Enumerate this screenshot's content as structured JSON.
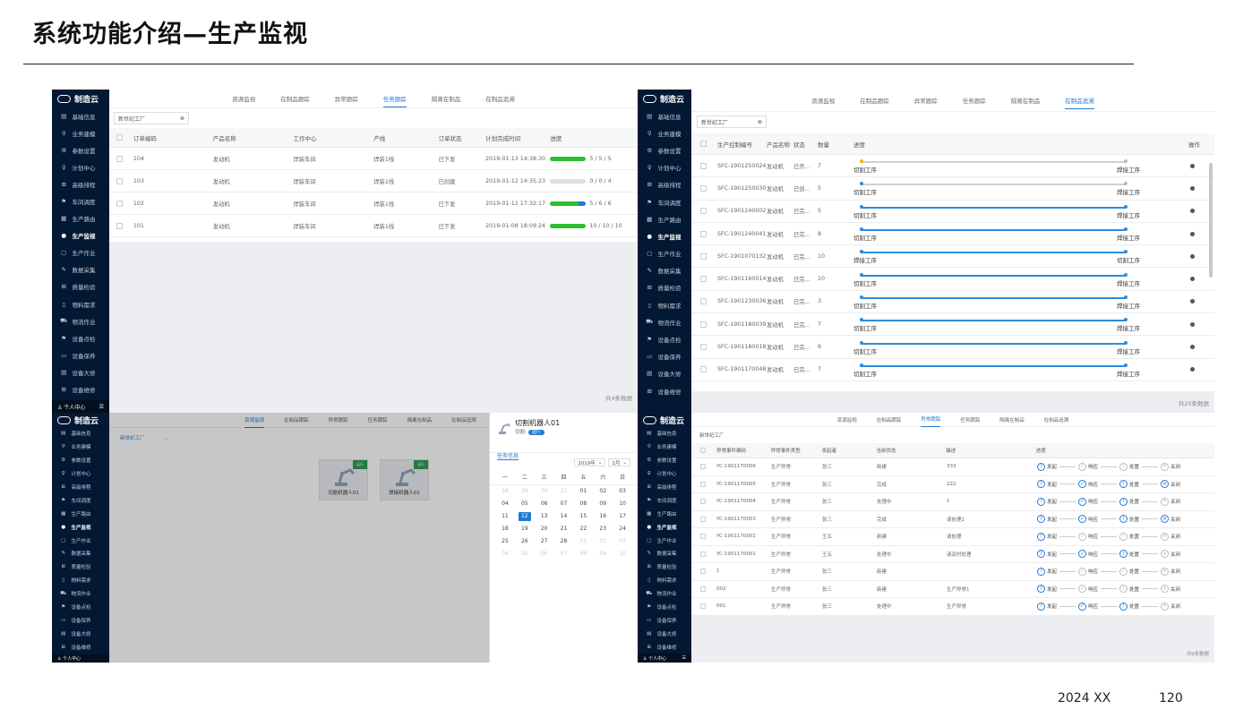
{
  "slide": {
    "title": "系统功能介绍—生产监视",
    "footer_left": "2024 XX",
    "footer_right": "120"
  },
  "app": {
    "brand": "制造云",
    "user_center": "个人中心",
    "menu_toggle": "☰"
  },
  "sidebar_items": [
    {
      "label": "基础信息",
      "icon": "▤"
    },
    {
      "label": "业务建模",
      "icon": "⚲"
    },
    {
      "label": "参数设置",
      "icon": "⚙"
    },
    {
      "label": "计划中心",
      "icon": "♀"
    },
    {
      "label": "高级排程",
      "icon": "⊞"
    },
    {
      "label": "车间调度",
      "icon": "⚑"
    },
    {
      "label": "生产路由",
      "icon": "▦"
    },
    {
      "label": "生产监视",
      "icon": "●",
      "active": true
    },
    {
      "label": "生产作业",
      "icon": "▢"
    },
    {
      "label": "数据采集",
      "icon": "✎"
    },
    {
      "label": "质量检验",
      "icon": "⊞"
    },
    {
      "label": "物料需求",
      "icon": "▯"
    },
    {
      "label": "物流作业",
      "icon": "⛟"
    },
    {
      "label": "设备点检",
      "icon": "⚑"
    },
    {
      "label": "设备保养",
      "icon": "▭"
    },
    {
      "label": "设备大修",
      "icon": "▤"
    },
    {
      "label": "设备维修",
      "icon": "⊞"
    }
  ],
  "tabs": [
    "资源监视",
    "在制品跟踪",
    "异常跟踪",
    "任务跟踪",
    "隔离在制品",
    "在制品追溯"
  ],
  "filter": {
    "factory": "新世纪工厂",
    "clear": "⊗",
    "dropdown": "新世纪工厂",
    "caret": "⌄"
  },
  "task_panel": {
    "columns": [
      "订单编码",
      "产品名称",
      "工作中心",
      "产线",
      "订单状态",
      "计划完成时间",
      "进度"
    ],
    "rows": [
      {
        "code": "104",
        "product": "发动机",
        "center": "焊装车间",
        "line": "焊装1线",
        "status": "已下发",
        "time": "2019-01-13 14:38:30",
        "progress": 1.0,
        "progress_text": "5 / 5 / 5",
        "mixed": false
      },
      {
        "code": "103",
        "product": "发动机",
        "center": "焊装车间",
        "line": "焊装1线",
        "status": "已创建",
        "time": "2019-01-12 14:35:23",
        "progress": 0.0,
        "progress_text": "0 / 0 / 4",
        "mixed": false
      },
      {
        "code": "102",
        "product": "发动机",
        "center": "焊装车间",
        "line": "焊装1线",
        "status": "已下发",
        "time": "2019-01-12 17:32:17",
        "progress": 1.0,
        "progress_text": "5 / 6 / 6",
        "mixed": true
      },
      {
        "code": "101",
        "product": "发动机",
        "center": "焊装车间",
        "line": "焊装1线",
        "status": "已下发",
        "time": "2019-01-08 18:09:24",
        "progress": 1.0,
        "progress_text": "10 / 10 / 10",
        "mixed": false
      }
    ],
    "total": "共4条数据"
  },
  "wip_panel": {
    "columns": [
      "生产控制编号",
      "产品名称",
      "状态",
      "数量",
      "进度",
      "操作"
    ],
    "rows": [
      {
        "code": "SFC-1901250024",
        "product": "发动机",
        "status": "已开...",
        "qty": "7",
        "from": "切割工序",
        "to": "焊接工序",
        "full": false
      },
      {
        "code": "SFC-1901250030",
        "product": "发动机",
        "status": "已创...",
        "qty": "5",
        "from": "切割工序",
        "to": "焊接工序",
        "full": false
      },
      {
        "code": "SFC-1901240002",
        "product": "发动机",
        "status": "已完...",
        "qty": "5",
        "from": "切割工序",
        "to": "焊接工序",
        "full": true
      },
      {
        "code": "SFC-1901240041",
        "product": "发动机",
        "status": "已完...",
        "qty": "8",
        "from": "切割工序",
        "to": "焊接工序",
        "full": true
      },
      {
        "code": "SFC-1901070132",
        "product": "发动机",
        "status": "已完...",
        "qty": "10",
        "from": "焊接工序",
        "to": "切割工序",
        "full": true
      },
      {
        "code": "SFC-1901160014",
        "product": "发动机",
        "status": "已完...",
        "qty": "10",
        "from": "切割工序",
        "to": "焊接工序",
        "full": true
      },
      {
        "code": "SFC-1901230036",
        "product": "发动机",
        "status": "已完...",
        "qty": "3",
        "from": "切割工序",
        "to": "焊接工序",
        "full": true
      },
      {
        "code": "SFC-1901180039",
        "product": "发动机",
        "status": "已完...",
        "qty": "7",
        "from": "切割工序",
        "to": "焊接工序",
        "full": true
      },
      {
        "code": "SFC-1901180018",
        "product": "发动机",
        "status": "已完...",
        "qty": "6",
        "from": "切割工序",
        "to": "焊接工序",
        "full": true
      },
      {
        "code": "SFC-1901170048",
        "product": "发动机",
        "status": "已完...",
        "qty": "7",
        "from": "切割工序",
        "to": "焊接工序",
        "full": true
      }
    ],
    "total": "共20条数据"
  },
  "resource_panel": {
    "cards": [
      {
        "name": "切割机器人01",
        "badge": "运行"
      },
      {
        "name": "焊接机器人01",
        "badge": "运行"
      }
    ],
    "drawer": {
      "title": "切割机器人01",
      "status_label": "切割:",
      "status_value": "运行",
      "tab": "任务信息",
      "year": "2019年",
      "month": "2月",
      "weekdays": [
        "一",
        "二",
        "三",
        "四",
        "五",
        "六",
        "日"
      ],
      "days": [
        {
          "d": "28",
          "dim": true
        },
        {
          "d": "29",
          "dim": true
        },
        {
          "d": "30",
          "dim": true
        },
        {
          "d": "31",
          "dim": true
        },
        {
          "d": "01"
        },
        {
          "d": "02"
        },
        {
          "d": "03"
        },
        {
          "d": "04"
        },
        {
          "d": "05"
        },
        {
          "d": "06"
        },
        {
          "d": "07"
        },
        {
          "d": "08"
        },
        {
          "d": "09"
        },
        {
          "d": "10"
        },
        {
          "d": "11"
        },
        {
          "d": "12",
          "sel": true
        },
        {
          "d": "13"
        },
        {
          "d": "14"
        },
        {
          "d": "15"
        },
        {
          "d": "16"
        },
        {
          "d": "17"
        },
        {
          "d": "18"
        },
        {
          "d": "19"
        },
        {
          "d": "20"
        },
        {
          "d": "21"
        },
        {
          "d": "22"
        },
        {
          "d": "23"
        },
        {
          "d": "24"
        },
        {
          "d": "25"
        },
        {
          "d": "26"
        },
        {
          "d": "27"
        },
        {
          "d": "28"
        },
        {
          "d": "01",
          "dim": true
        },
        {
          "d": "02",
          "dim": true
        },
        {
          "d": "03",
          "dim": true
        },
        {
          "d": "04",
          "dim": true
        },
        {
          "d": "05",
          "dim": true
        },
        {
          "d": "06",
          "dim": true
        },
        {
          "d": "07",
          "dim": true
        },
        {
          "d": "08",
          "dim": true
        },
        {
          "d": "09",
          "dim": true
        },
        {
          "d": "10",
          "dim": true
        }
      ]
    }
  },
  "exception_panel": {
    "columns": [
      "异常事件编码",
      "异常事件类型",
      "发起者",
      "当前状态",
      "描述",
      "进度"
    ],
    "steps": [
      "发起",
      "响应",
      "处置",
      "关闭"
    ],
    "step_icons": [
      "?",
      "✓",
      "!",
      "✕"
    ],
    "rows": [
      {
        "code": "YC-1901170006",
        "type": "生产异常",
        "by": "张三",
        "state": "新建",
        "desc": "333",
        "done": 1
      },
      {
        "code": "YC-1901170005",
        "type": "生产异常",
        "by": "张三",
        "state": "完成",
        "desc": "222",
        "done": 4
      },
      {
        "code": "YC-1901170004",
        "type": "生产异常",
        "by": "张三",
        "state": "处理中",
        "desc": "1",
        "done": 3
      },
      {
        "code": "YC-1901170003",
        "type": "生产异常",
        "by": "张三",
        "state": "完成",
        "desc": "请处理2",
        "done": 4
      },
      {
        "code": "YC-1901170002",
        "type": "生产异常",
        "by": "王五",
        "state": "新建",
        "desc": "请处理",
        "done": 1
      },
      {
        "code": "YC-1901170001",
        "type": "生产异常",
        "by": "王五",
        "state": "处理中",
        "desc": "请及时处理",
        "done": 3
      },
      {
        "code": "1",
        "type": "生产异常",
        "by": "张三",
        "state": "新建",
        "desc": "",
        "done": 1
      },
      {
        "code": "002",
        "type": "生产异常",
        "by": "张三",
        "state": "新建",
        "desc": "生产异常1",
        "done": 1
      },
      {
        "code": "001",
        "type": "生产异常",
        "by": "张三",
        "state": "处理中",
        "desc": "生产异常",
        "done": 3
      }
    ],
    "total": "共9条数据"
  }
}
